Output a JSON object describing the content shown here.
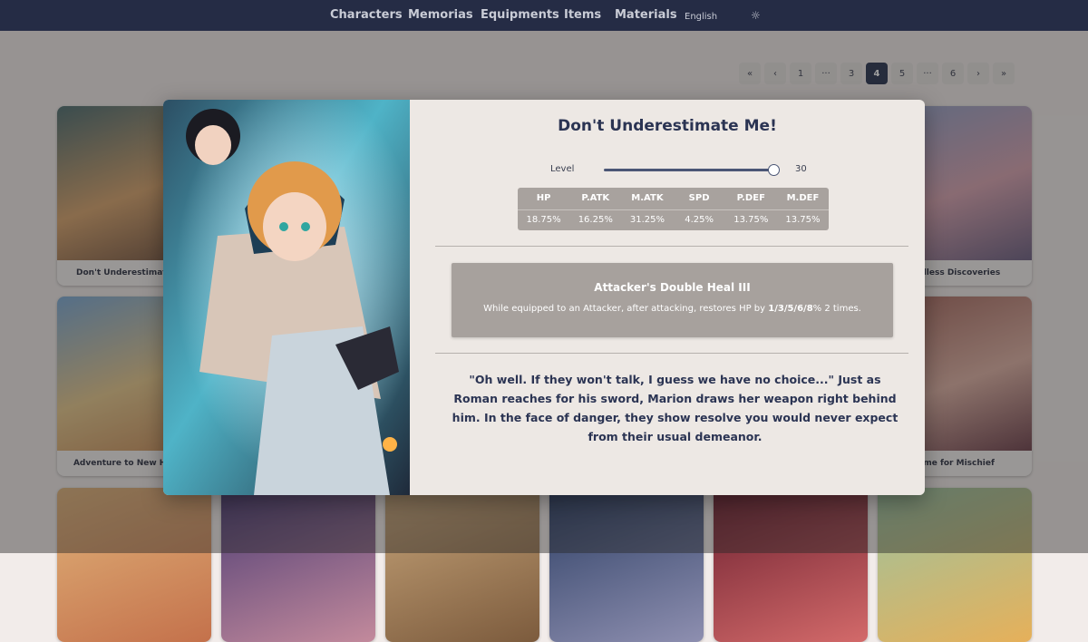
{
  "nav": {
    "items": [
      "Characters",
      "Memorias",
      "Equipments",
      "Items",
      "Materials"
    ],
    "language": "English",
    "theme_icon": "sun-icon"
  },
  "pagination": {
    "first": "«",
    "prev": "‹",
    "pages": [
      "1",
      "···",
      "3",
      "4",
      "5",
      "···",
      "6"
    ],
    "active": "4",
    "next": "›",
    "last": "»"
  },
  "grid": {
    "cards": [
      {
        "title": "Don't Underestimate Me!"
      },
      {
        "title": "Endless Discoveries"
      },
      {
        "title": "Adventure to New Heights"
      },
      {
        "title": "Time for Mischief"
      }
    ]
  },
  "modal": {
    "title": "Don't Underestimate Me!",
    "level_label": "Level",
    "level_value": "30",
    "level_fraction": 1.0,
    "stats": {
      "headers": [
        "HP",
        "P.ATK",
        "M.ATK",
        "SPD",
        "P.DEF",
        "M.DEF"
      ],
      "values": [
        "18.75%",
        "16.25%",
        "31.25%",
        "4.25%",
        "13.75%",
        "13.75%"
      ]
    },
    "skill": {
      "name": "Attacker's Double Heal III",
      "desc_prefix": "While equipped to an Attacker, after attacking, restores HP by ",
      "desc_bold": "1/3/5/6/8",
      "desc_suffix": "% 2 times."
    },
    "flavor": "\"Oh well. If they won't talk, I guess we have no choice...\" Just as Roman reaches for his sword, Marion draws her weapon right behind him. In the face of danger, they show resolve you would never expect from their usual demeanor."
  }
}
